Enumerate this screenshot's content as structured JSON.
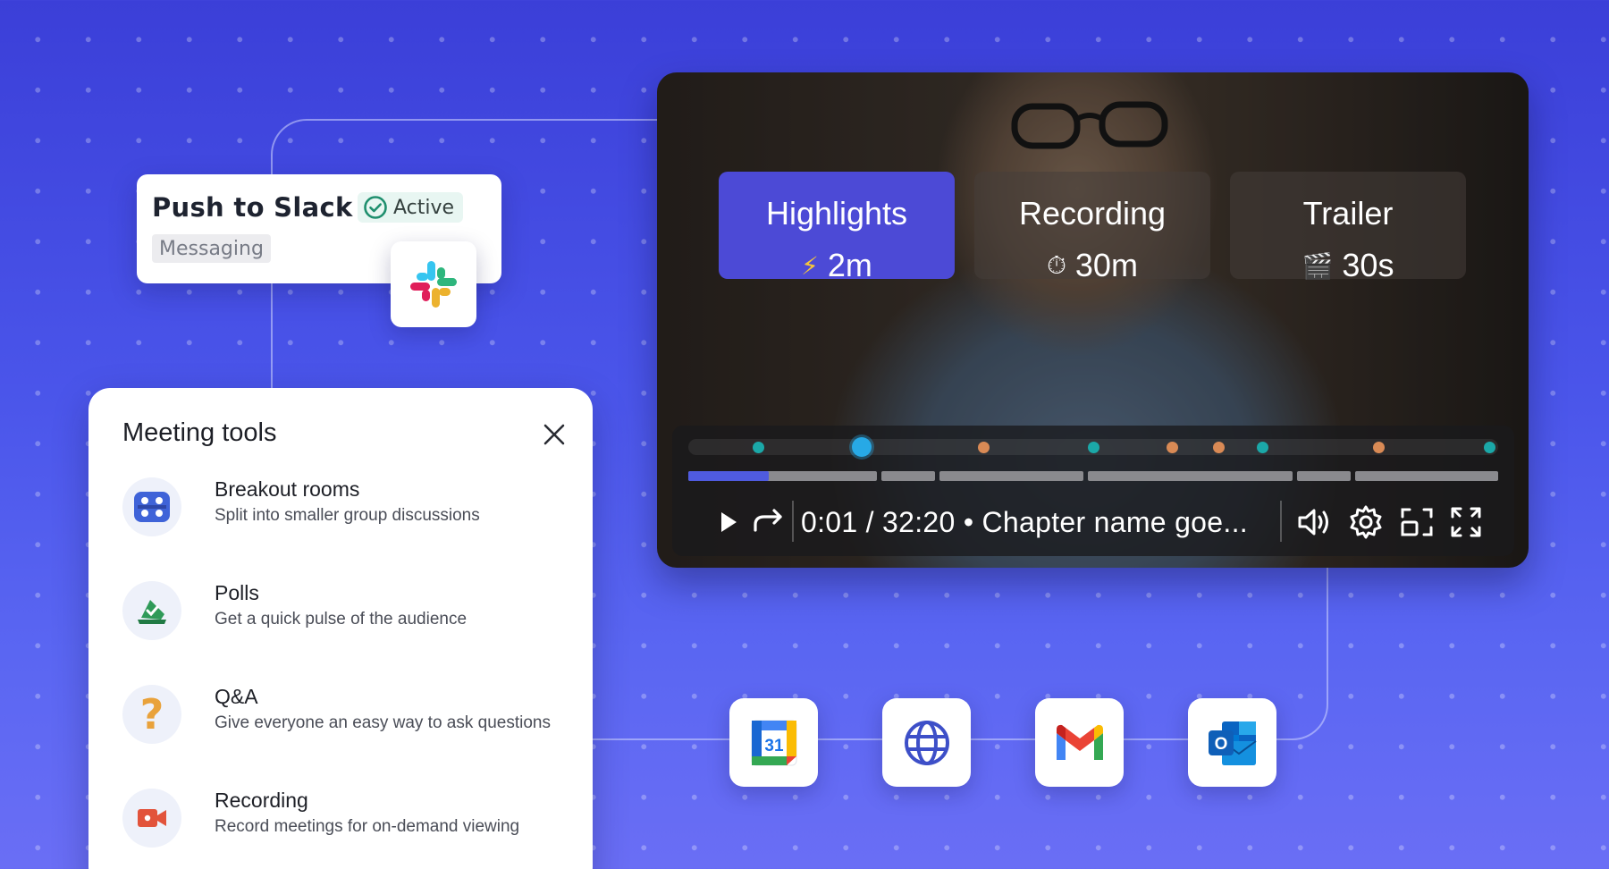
{
  "slack_card": {
    "title": "Push to Slack",
    "status": "Active",
    "category": "Messaging",
    "logo": "slack-icon"
  },
  "meeting_tools": {
    "title": "Meeting tools",
    "close_icon": "close-icon",
    "items": [
      {
        "name": "Breakout rooms",
        "description": "Split into smaller group discussions",
        "icon": "breakout-rooms-icon"
      },
      {
        "name": "Polls",
        "description": "Get a quick pulse of the audience",
        "icon": "poll-icon"
      },
      {
        "name": "Q&A",
        "description": "Give everyone an easy way to ask questions",
        "icon": "question-icon"
      },
      {
        "name": "Recording",
        "description": "Record meetings for on-demand viewing",
        "icon": "video-camera-icon"
      }
    ]
  },
  "video": {
    "tabs": [
      {
        "label": "Highlights",
        "value": "2m",
        "icon": "⚡",
        "active": true
      },
      {
        "label": "Recording",
        "value": "30m",
        "icon": "⏱",
        "active": false
      },
      {
        "label": "Trailer",
        "value": "30s",
        "icon": "🎬",
        "active": false
      }
    ],
    "time": "0:01 / 32:20 • Chapter name goe...",
    "controls": [
      "play-icon",
      "forward-icon",
      "volume-icon",
      "settings-icon",
      "picture-in-picture-icon",
      "fullscreen-icon"
    ]
  },
  "apps": [
    "google-calendar-icon",
    "web-globe-icon",
    "gmail-icon",
    "outlook-icon"
  ],
  "calendar_day": "31",
  "outlook_letter": "O",
  "colors": {
    "accent": "#4c4ad6",
    "active_green": "#1f8f6e",
    "marker_teal": "#1ba8a8",
    "marker_orange": "#d98a55"
  }
}
